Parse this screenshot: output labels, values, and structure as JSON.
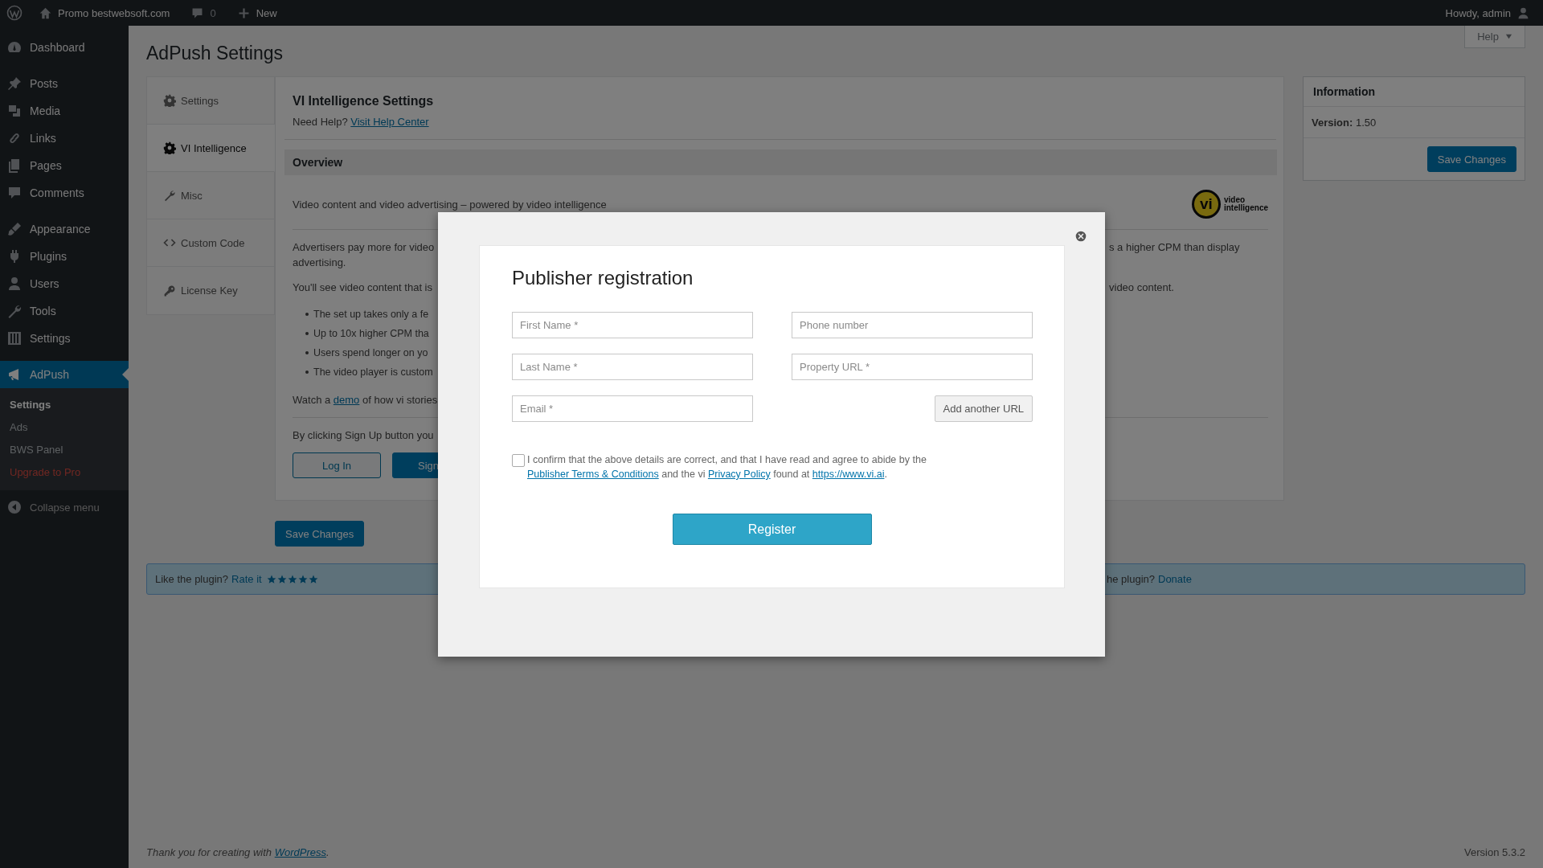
{
  "top_bar": {
    "site_name": "Promo bestwebsoft.com",
    "comments_count": "0",
    "new_label": "New",
    "greeting": "Howdy, admin"
  },
  "sidebar": {
    "groups": [
      {
        "items": [
          {
            "label": "Dashboard",
            "selected": false
          }
        ]
      },
      {
        "items": [
          {
            "label": "Posts",
            "selected": false
          },
          {
            "label": "Media",
            "selected": false
          },
          {
            "label": "Links",
            "selected": false
          },
          {
            "label": "Pages",
            "selected": false
          },
          {
            "label": "Comments",
            "selected": false
          }
        ]
      },
      {
        "items": [
          {
            "label": "Appearance",
            "selected": false
          },
          {
            "label": "Plugins",
            "selected": false
          },
          {
            "label": "Users",
            "selected": false
          },
          {
            "label": "Tools",
            "selected": false
          },
          {
            "label": "Settings",
            "selected": false
          }
        ]
      },
      {
        "items": [
          {
            "label": "AdPush",
            "selected": true,
            "submenu": [
              {
                "label": "Settings",
                "selected": true,
                "kind": "link"
              },
              {
                "label": "Ads",
                "selected": false,
                "kind": "link"
              },
              {
                "label": "BWS Panel",
                "selected": false,
                "kind": "link"
              },
              {
                "label": "Upgrade to Pro",
                "selected": false,
                "kind": "promo"
              }
            ]
          }
        ]
      }
    ],
    "collapse_label": "Collapse menu"
  },
  "page": {
    "title": "AdPush Settings",
    "help_button": "Help",
    "tabs": [
      {
        "label": "Settings",
        "selected": false
      },
      {
        "label": "VI Intelligence",
        "selected": true
      },
      {
        "label": "Misc",
        "selected": false
      },
      {
        "label": "Custom Code",
        "selected": false
      },
      {
        "label": "License Key",
        "selected": false
      }
    ],
    "panel": {
      "heading": "VI Intelligence Settings",
      "help_prefix": "Need Help?",
      "help_link": "Visit Help Center",
      "section_title": "Overview",
      "tagline": "Video content and video advertising – powered by video intelligence",
      "logo": {
        "mark": "vi",
        "line_1": "video",
        "line_2": "intelligence"
      },
      "body": [
        {
          "kind": "paragraph",
          "lines": [
            {
              "left": "Advertisers pay more for video",
              "right": "s a higher CPM than display"
            },
            {
              "left": "advertising."
            }
          ]
        },
        {
          "kind": "paragraph",
          "lines": [
            {
              "left": "You'll see video content that is",
              "right": "video content."
            }
          ]
        },
        {
          "kind": "bullets",
          "items": [
            "The set up takes only a fe",
            "Up to 10x higher CPM tha",
            "Users spend longer on yo",
            "The video player is custom"
          ]
        },
        {
          "kind": "link_line",
          "before": "Watch a",
          "link": "demo",
          "after": "of how vi stories"
        }
      ],
      "signup_note": "By clicking Sign Up button you",
      "login_button": "Log In",
      "signup_button": "Sign"
    },
    "save_button": "Save Changes",
    "info": {
      "title": "Information",
      "version": "**Version:** 1.50",
      "save_button": "Save Changes"
    },
    "notice": {
      "left_text": "Like the plugin?",
      "rate_link": "Rate it",
      "stars": 5,
      "right_text": "he plugin?",
      "donate_link": "Donate"
    }
  },
  "footer": {
    "thanks_text": "Thank you for creating with",
    "thanks_link": "WordPress",
    "thanks_end": ".",
    "version": "Version 5.3.2"
  },
  "modal": {
    "title": "Publisher registration",
    "fields": [
      {
        "placeholder": "First Name *"
      },
      {
        "placeholder": "Phone number"
      },
      {
        "placeholder": "Last Name *"
      },
      {
        "placeholder": "Property URL *"
      },
      {
        "placeholder": "Email *"
      }
    ],
    "add_url_button": "Add another URL",
    "consent": {
      "checked": false,
      "text_before": "I confirm that the above details are correct, and that I have read and agree to abide by the",
      "terms_link": "Publisher Terms & Conditions",
      "text_middle": "and the vi",
      "privacy_link": "Privacy Policy",
      "text_after": "found at",
      "site_link": "https://www.vi.ai",
      "text_end": "."
    },
    "register_button": "Register"
  }
}
